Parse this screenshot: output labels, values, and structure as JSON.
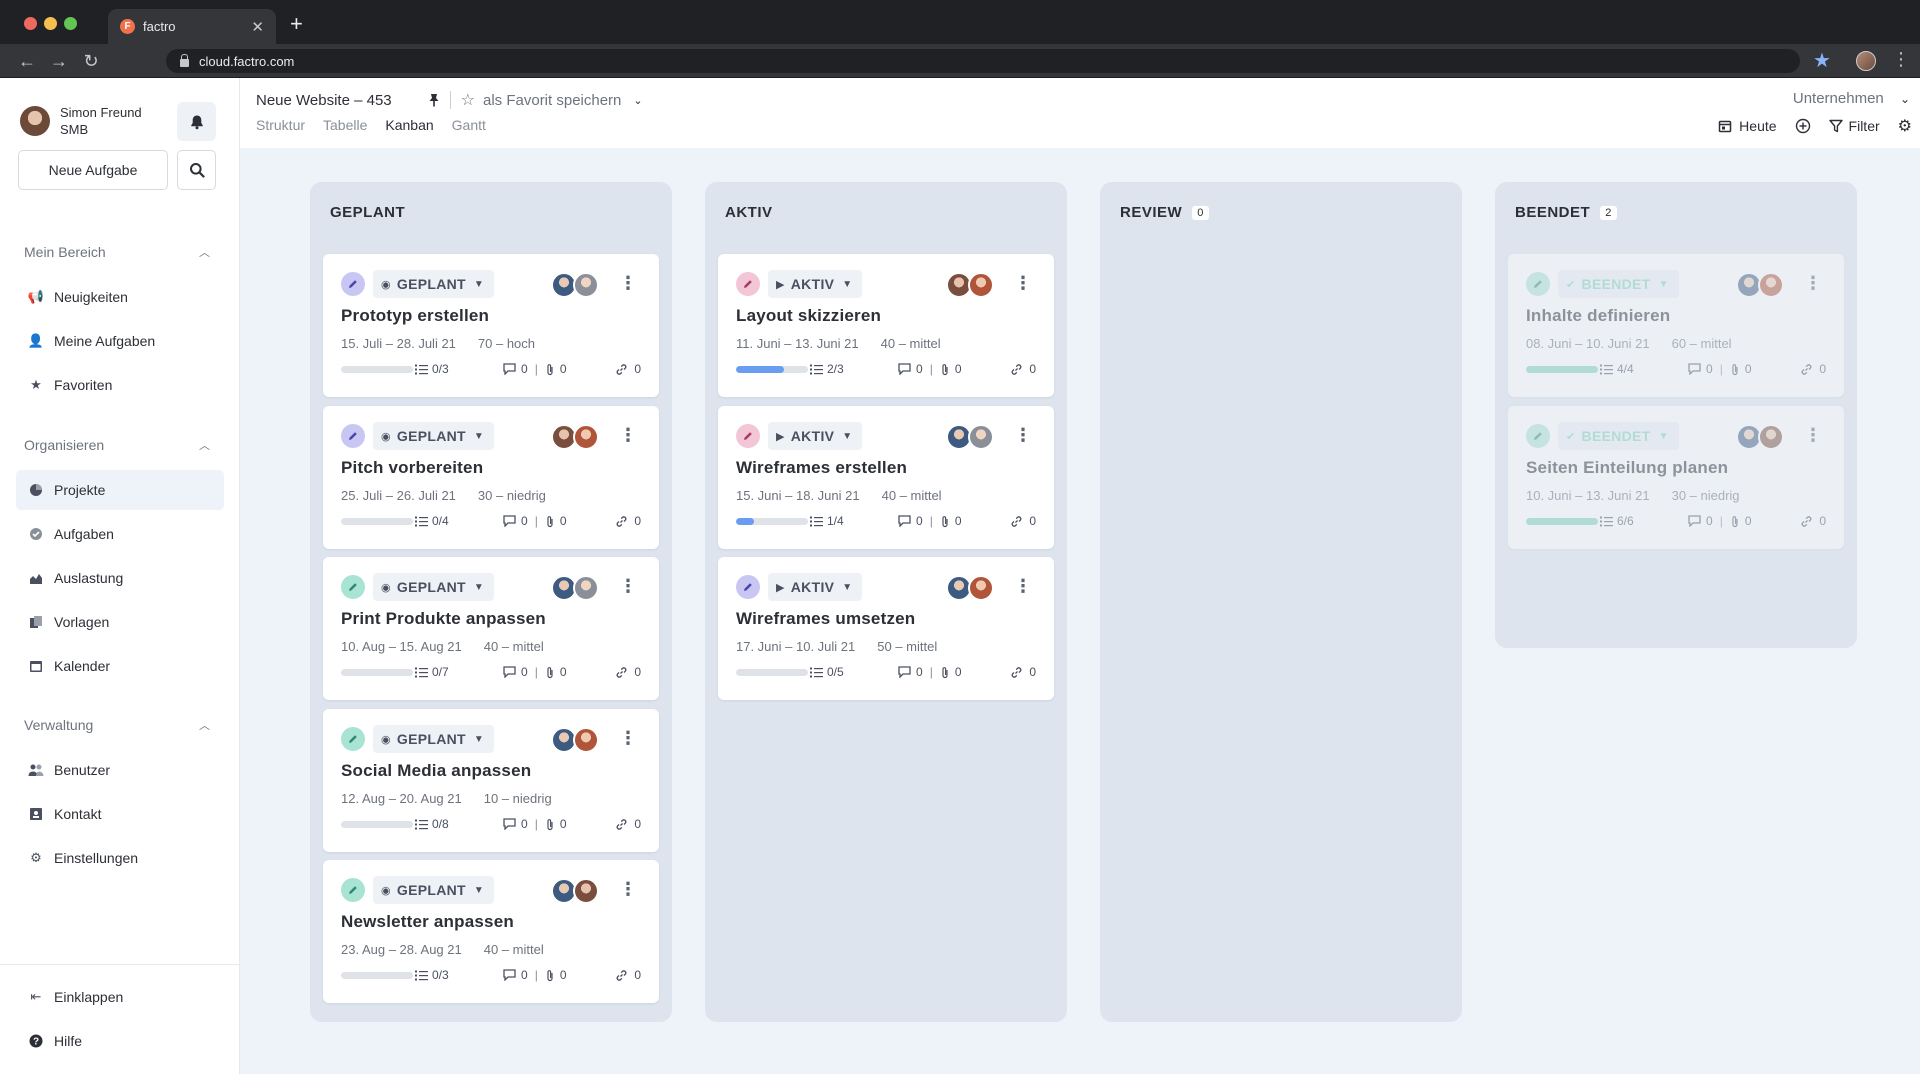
{
  "browser": {
    "tab_title": "factro",
    "tab_favicon_letter": "F",
    "url": "cloud.factro.com",
    "new_tab": "+",
    "close_tab": "✕"
  },
  "user": {
    "name": "Simon Freund",
    "company": "SMB"
  },
  "sidebar": {
    "new_task_label": "Neue Aufgabe",
    "sections": [
      {
        "title": "Mein Bereich",
        "items": [
          "Neuigkeiten",
          "Meine Aufgaben",
          "Favoriten"
        ]
      },
      {
        "title": "Organisieren",
        "items": [
          "Projekte",
          "Aufgaben",
          "Auslastung",
          "Vorlagen",
          "Kalender"
        ]
      },
      {
        "title": "Verwaltung",
        "items": [
          "Benutzer",
          "Kontakt",
          "Einstellungen"
        ]
      }
    ],
    "active_item": "Projekte",
    "collapse_label": "Einklappen",
    "help_label": "Hilfe"
  },
  "header": {
    "project_title": "Neue Website – 453",
    "favorite_label": "als Favorit speichern",
    "views": [
      "Struktur",
      "Tabelle",
      "Kanban",
      "Gantt"
    ],
    "active_view": "Kanban",
    "company_select": "Unternehmen",
    "today_label": "Heute",
    "filter_label": "Filter"
  },
  "colors": {
    "accent_blue": "#6a9df0",
    "done_green": "#7ed4b8",
    "icon_purple": "#c8c6f2",
    "icon_pink": "#f2c6d7",
    "icon_teal": "#a8e3d3"
  },
  "columns": [
    {
      "title": "GEPLANT",
      "count": "",
      "cards": [
        {
          "status": "GEPLANT",
          "title": "Prototyp erstellen",
          "dates": "15. Juli – 28. Juli 21",
          "priority": "70 – hoch",
          "subtasks": "0/3",
          "progress": 0,
          "comments": "0",
          "attachments": "0",
          "links": "0",
          "icon_color": "purple"
        },
        {
          "status": "GEPLANT",
          "title": "Pitch vorbereiten",
          "dates": "25. Juli – 26. Juli 21",
          "priority": "30 – niedrig",
          "subtasks": "0/4",
          "progress": 0,
          "comments": "0",
          "attachments": "0",
          "links": "0",
          "icon_color": "purple"
        },
        {
          "status": "GEPLANT",
          "title": "Print Produkte anpassen",
          "dates": "10. Aug – 15. Aug 21",
          "priority": "40 – mittel",
          "subtasks": "0/7",
          "progress": 0,
          "comments": "0",
          "attachments": "0",
          "links": "0",
          "icon_color": "teal"
        },
        {
          "status": "GEPLANT",
          "title": "Social Media anpassen",
          "dates": "12. Aug – 20. Aug 21",
          "priority": "10 – niedrig",
          "subtasks": "0/8",
          "progress": 0,
          "comments": "0",
          "attachments": "0",
          "links": "0",
          "icon_color": "teal"
        },
        {
          "status": "GEPLANT",
          "title": "Newsletter anpassen",
          "dates": "23. Aug – 28. Aug 21",
          "priority": "40 – mittel",
          "subtasks": "0/3",
          "progress": 0,
          "comments": "0",
          "attachments": "0",
          "links": "0",
          "icon_color": "teal"
        }
      ]
    },
    {
      "title": "AKTIV",
      "count": "",
      "cards": [
        {
          "status": "AKTIV",
          "title": "Layout skizzieren",
          "dates": "11. Juni – 13. Juni 21",
          "priority": "40 – mittel",
          "subtasks": "2/3",
          "progress": 0.67,
          "comments": "0",
          "attachments": "0",
          "links": "0",
          "icon_color": "pink"
        },
        {
          "status": "AKTIV",
          "title": "Wireframes erstellen",
          "dates": "15. Juni – 18. Juni 21",
          "priority": "40 – mittel",
          "subtasks": "1/4",
          "progress": 0.25,
          "comments": "0",
          "attachments": "0",
          "links": "0",
          "icon_color": "pink"
        },
        {
          "status": "AKTIV",
          "title": "Wireframes umsetzen",
          "dates": "17. Juni – 10. Juli 21",
          "priority": "50 – mittel",
          "subtasks": "0/5",
          "progress": 0,
          "comments": "0",
          "attachments": "0",
          "links": "0",
          "icon_color": "purple"
        }
      ]
    },
    {
      "title": "REVIEW",
      "count": "0",
      "cards": []
    },
    {
      "title": "BEENDET",
      "count": "2",
      "cards": [
        {
          "status": "BEENDET",
          "title": "Inhalte definieren",
          "dates": "08. Juni – 10. Juni 21",
          "priority": "60 – mittel",
          "subtasks": "4/4",
          "progress": 1,
          "comments": "0",
          "attachments": "0",
          "links": "0",
          "icon_color": "teal"
        },
        {
          "status": "BEENDET",
          "title": "Seiten Einteilung planen",
          "dates": "10. Juni – 13. Juni 21",
          "priority": "30 – niedrig",
          "subtasks": "6/6",
          "progress": 1,
          "comments": "0",
          "attachments": "0",
          "links": "0",
          "icon_color": "teal"
        }
      ]
    }
  ]
}
